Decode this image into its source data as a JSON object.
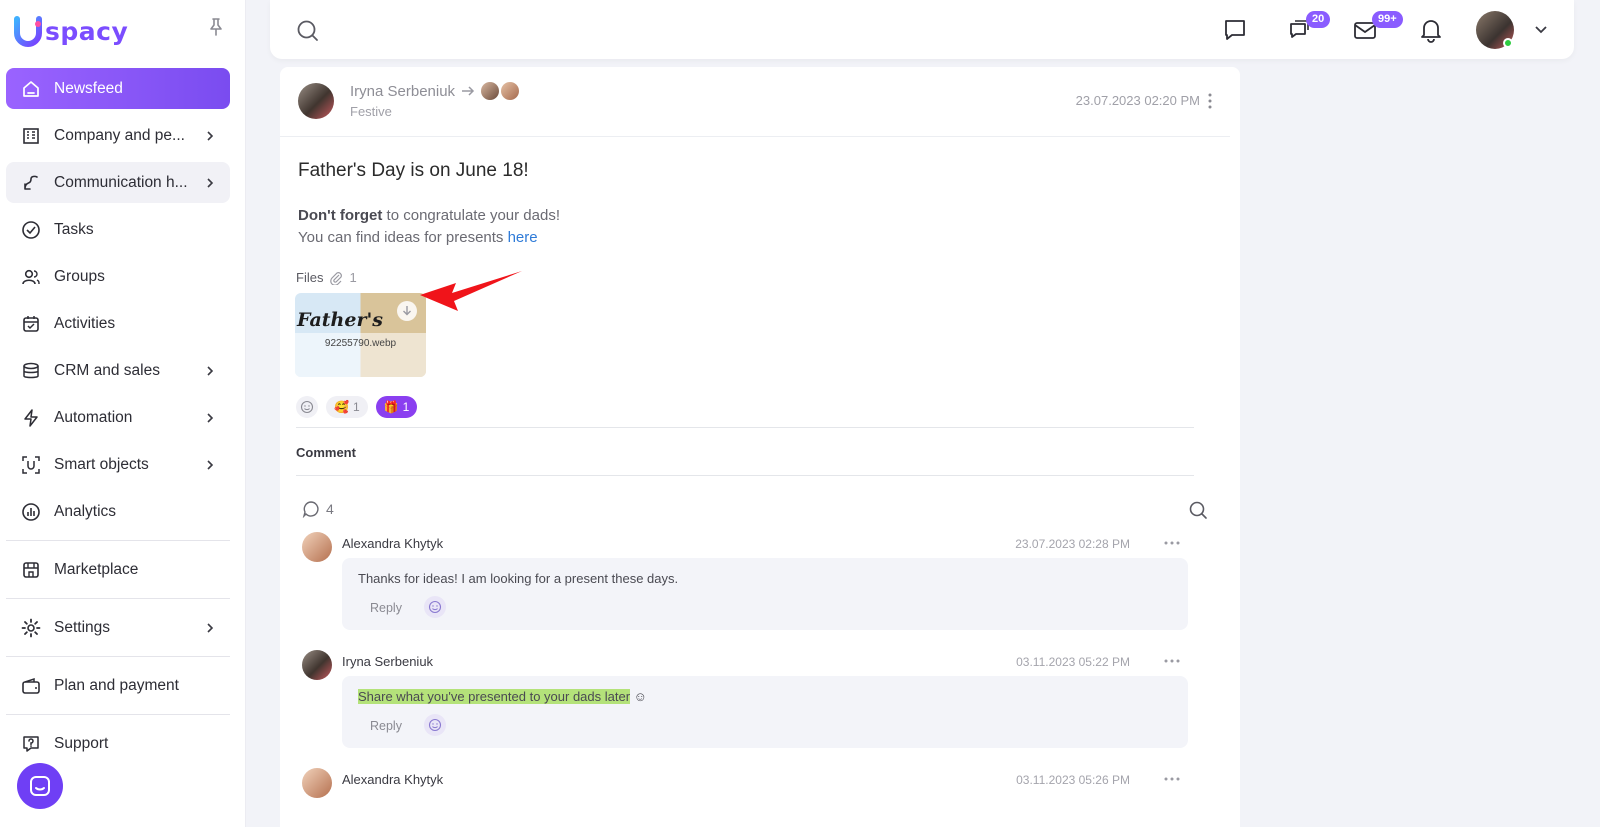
{
  "logo": {
    "text": "spacy",
    "brand_color": "#7b4dff"
  },
  "sidebar": {
    "items": [
      {
        "label": "Newsfeed",
        "icon": "home-icon",
        "active": true
      },
      {
        "label": "Company and pe...",
        "icon": "building-icon",
        "has_children": true
      },
      {
        "label": "Communication h...",
        "icon": "communication-icon",
        "has_children": true
      },
      {
        "label": "Tasks",
        "icon": "check-circle-icon"
      },
      {
        "label": "Groups",
        "icon": "users-icon"
      },
      {
        "label": "Activities",
        "icon": "calendar-icon"
      },
      {
        "label": "CRM and sales",
        "icon": "database-icon",
        "has_children": true
      },
      {
        "label": "Automation",
        "icon": "lightning-icon",
        "has_children": true
      },
      {
        "label": "Smart objects",
        "icon": "smart-object-icon",
        "has_children": true
      },
      {
        "label": "Analytics",
        "icon": "chart-icon"
      },
      {
        "label": "Marketplace",
        "icon": "store-icon"
      },
      {
        "label": "Settings",
        "icon": "gear-icon",
        "has_children": true
      },
      {
        "label": "Plan and payment",
        "icon": "wallet-icon"
      },
      {
        "label": "Support",
        "icon": "help-icon"
      }
    ]
  },
  "header": {
    "chat_badge": "20",
    "mail_badge": "99+"
  },
  "post": {
    "author": "Iryna Serbeniuk",
    "category": "Festive",
    "date": "23.07.2023 02:20 PM",
    "title": "Father's Day is on June 18!",
    "body_bold": "Don't forget",
    "body_rest": " to congratulate your dads!",
    "body_line2": "You can find ideas for presents ",
    "body_link": "here",
    "files_label": "Files",
    "files_count": "1",
    "file": {
      "thumb_text": "Father's",
      "name": "92255790.webp"
    },
    "reactions": [
      {
        "emoji": "🥰",
        "count": "1",
        "active": false
      },
      {
        "emoji": "🎁",
        "count": "1",
        "active": true
      }
    ],
    "comment_label": "Comment",
    "comment_count": "4"
  },
  "comments": [
    {
      "author": "Alexandra Khytyk",
      "date": "23.07.2023 02:28 PM",
      "text": "Thanks for ideas! I am looking for a present these days.",
      "highlight": "",
      "suffix": "",
      "reply": "Reply"
    },
    {
      "author": "Iryna Serbeniuk",
      "date": "03.11.2023 05:22 PM",
      "text": "",
      "highlight": "Share what you've presented to your dads later",
      "suffix": " ☺",
      "reply": "Reply"
    },
    {
      "author": "Alexandra Khytyk",
      "date": "03.11.2023 05:26 PM"
    }
  ]
}
